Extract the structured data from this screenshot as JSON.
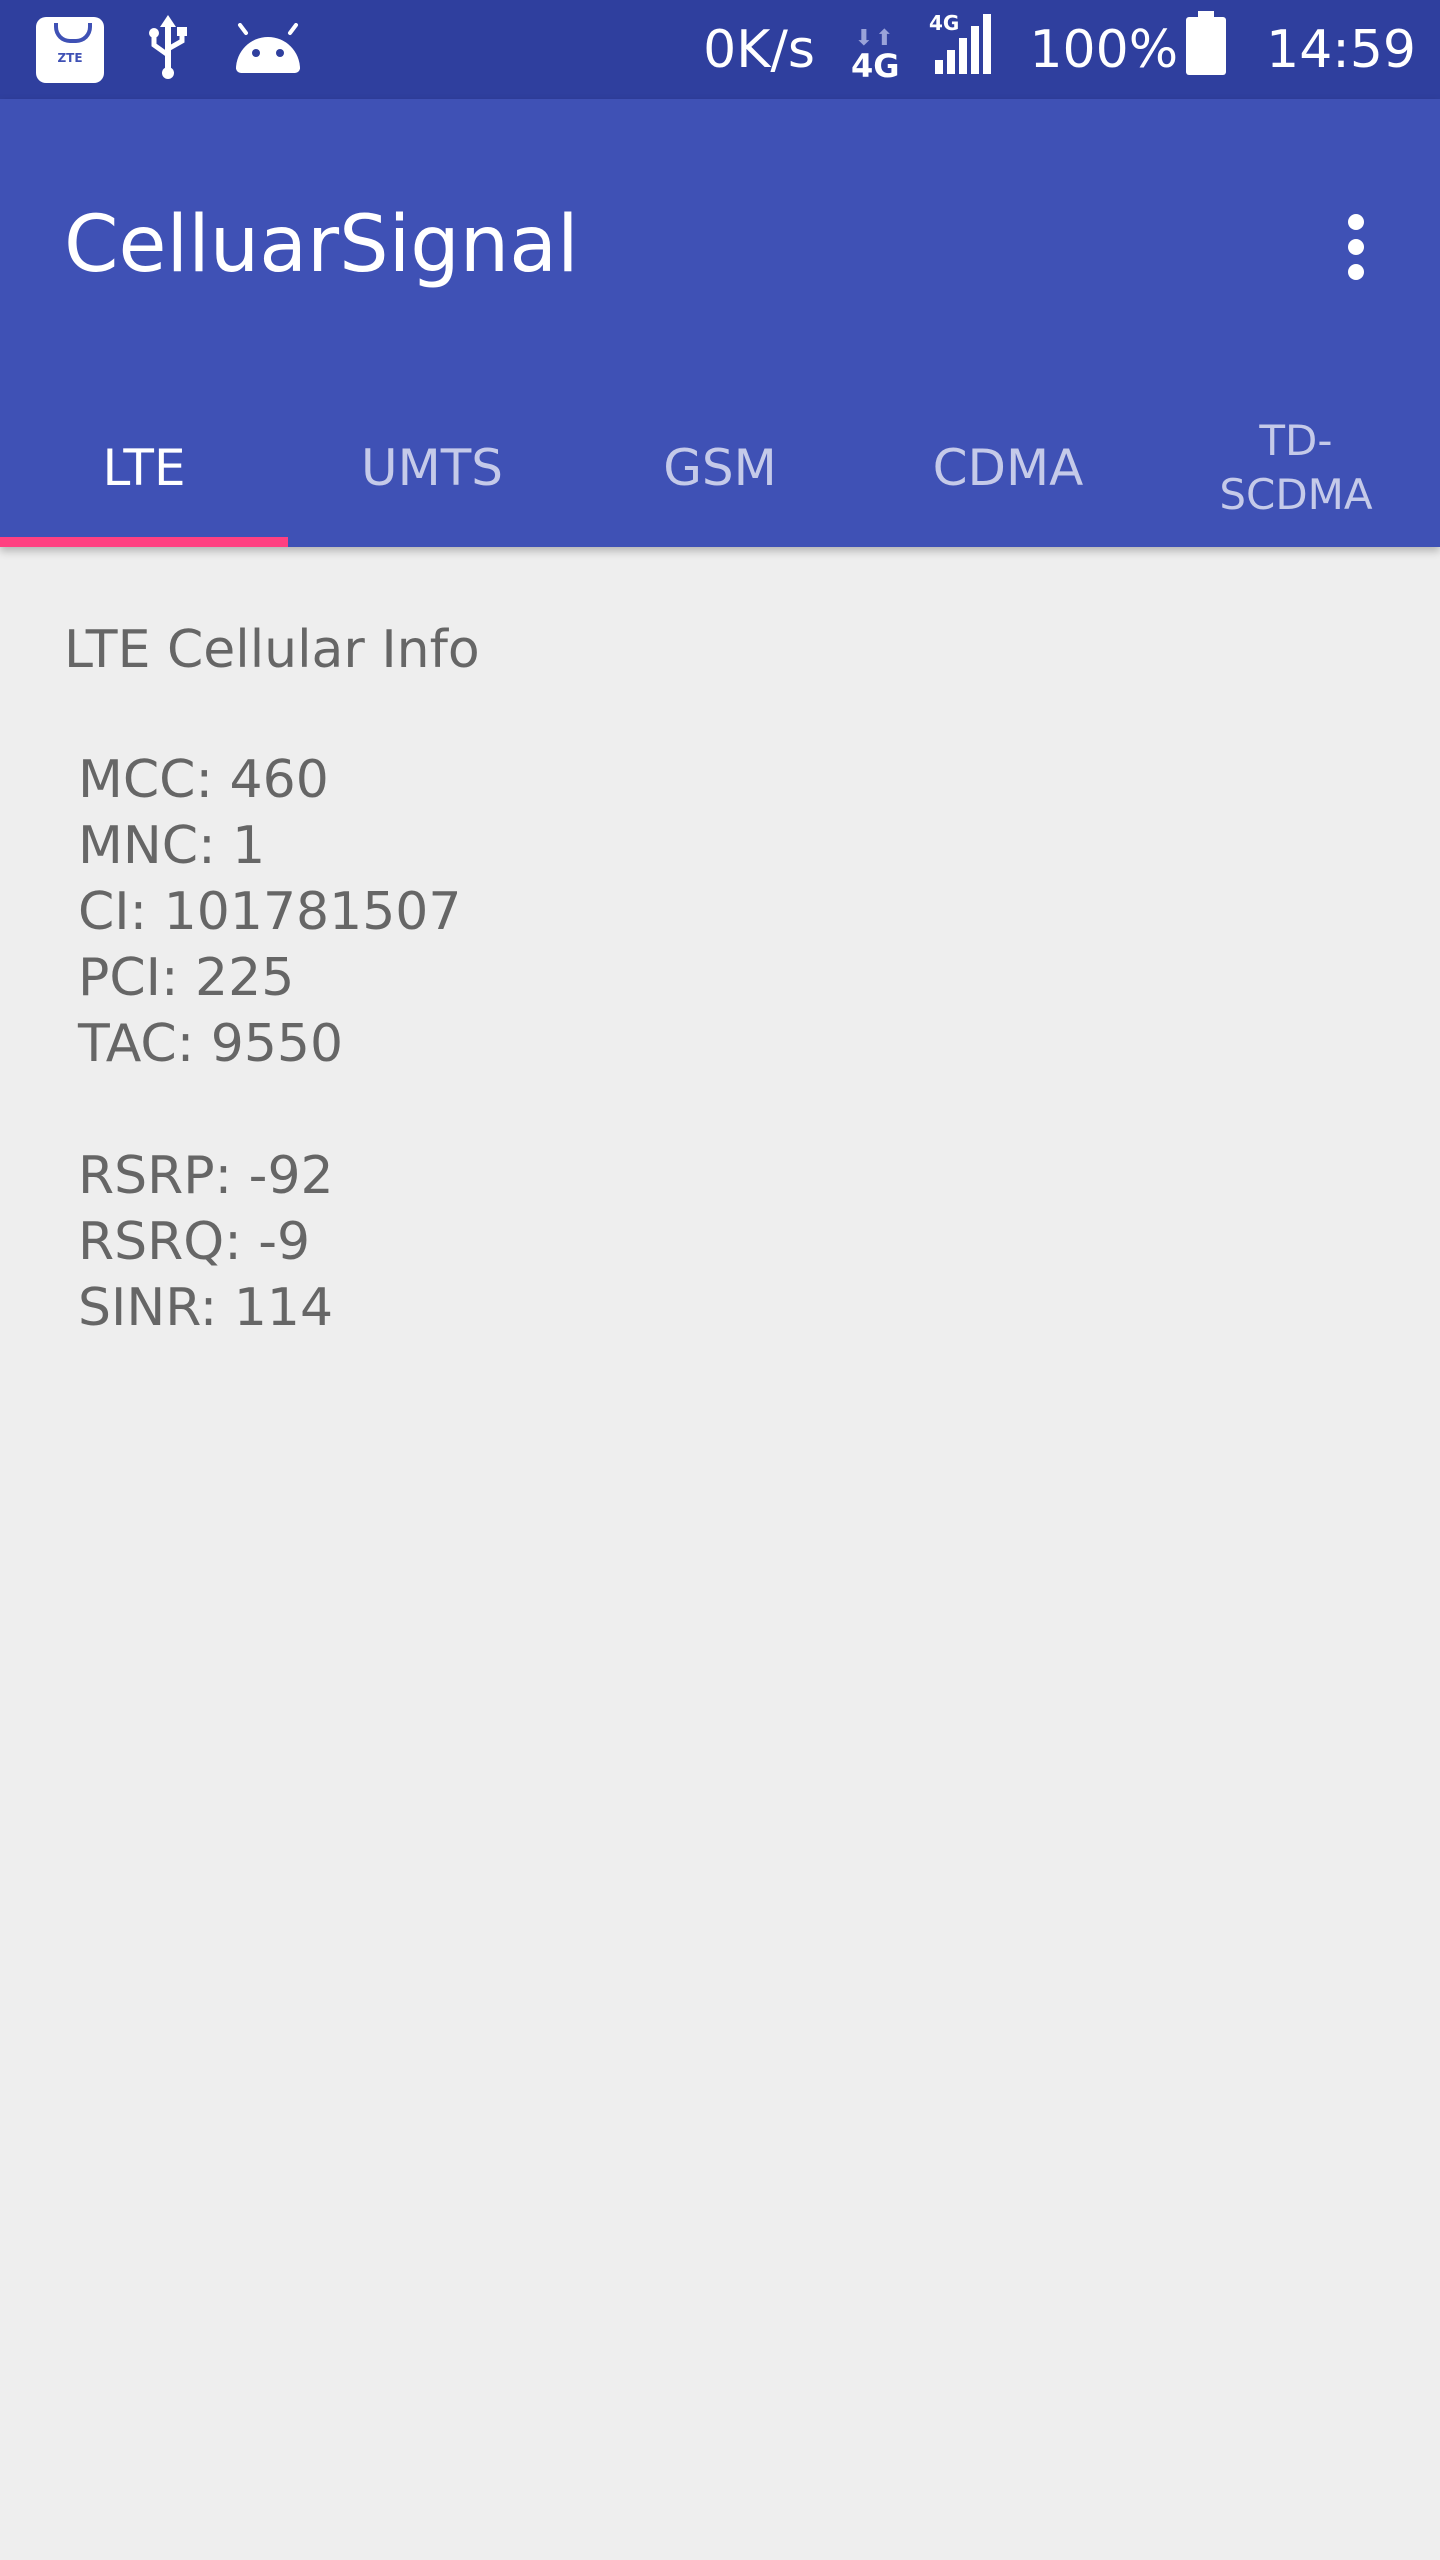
{
  "status_bar": {
    "notification_icons": [
      "zte-app-icon",
      "usb-icon",
      "android-debug-icon"
    ],
    "zte_label": "ZTE",
    "net_speed": "0K/s",
    "net_type_1": "4G",
    "net_type_2": "4G",
    "battery_percent": "100%",
    "time": "14:59"
  },
  "app_bar": {
    "title": "CelluarSignal",
    "overflow_icon": "more-vert-icon"
  },
  "tabs": [
    {
      "label": "LTE",
      "active": true
    },
    {
      "label": "UMTS",
      "active": false
    },
    {
      "label": "GSM",
      "active": false
    },
    {
      "label": "CDMA",
      "active": false
    },
    {
      "label": "TD-\nSCDMA",
      "active": false
    }
  ],
  "content": {
    "title": "LTE Cellular Info",
    "cell_identity": [
      "MCC: 460",
      "MNC: 1",
      "CI: 101781507",
      "PCI: 225",
      "TAC: 9550"
    ],
    "signal_strength": [
      "RSRP: -92",
      "RSRQ: -9",
      "SINR: 114"
    ]
  },
  "colors": {
    "status_bar": "#2f3f9e",
    "primary": "#3f51b5",
    "tab_indicator": "#ff4081",
    "background": "#eeeeee",
    "text": "#666666"
  }
}
